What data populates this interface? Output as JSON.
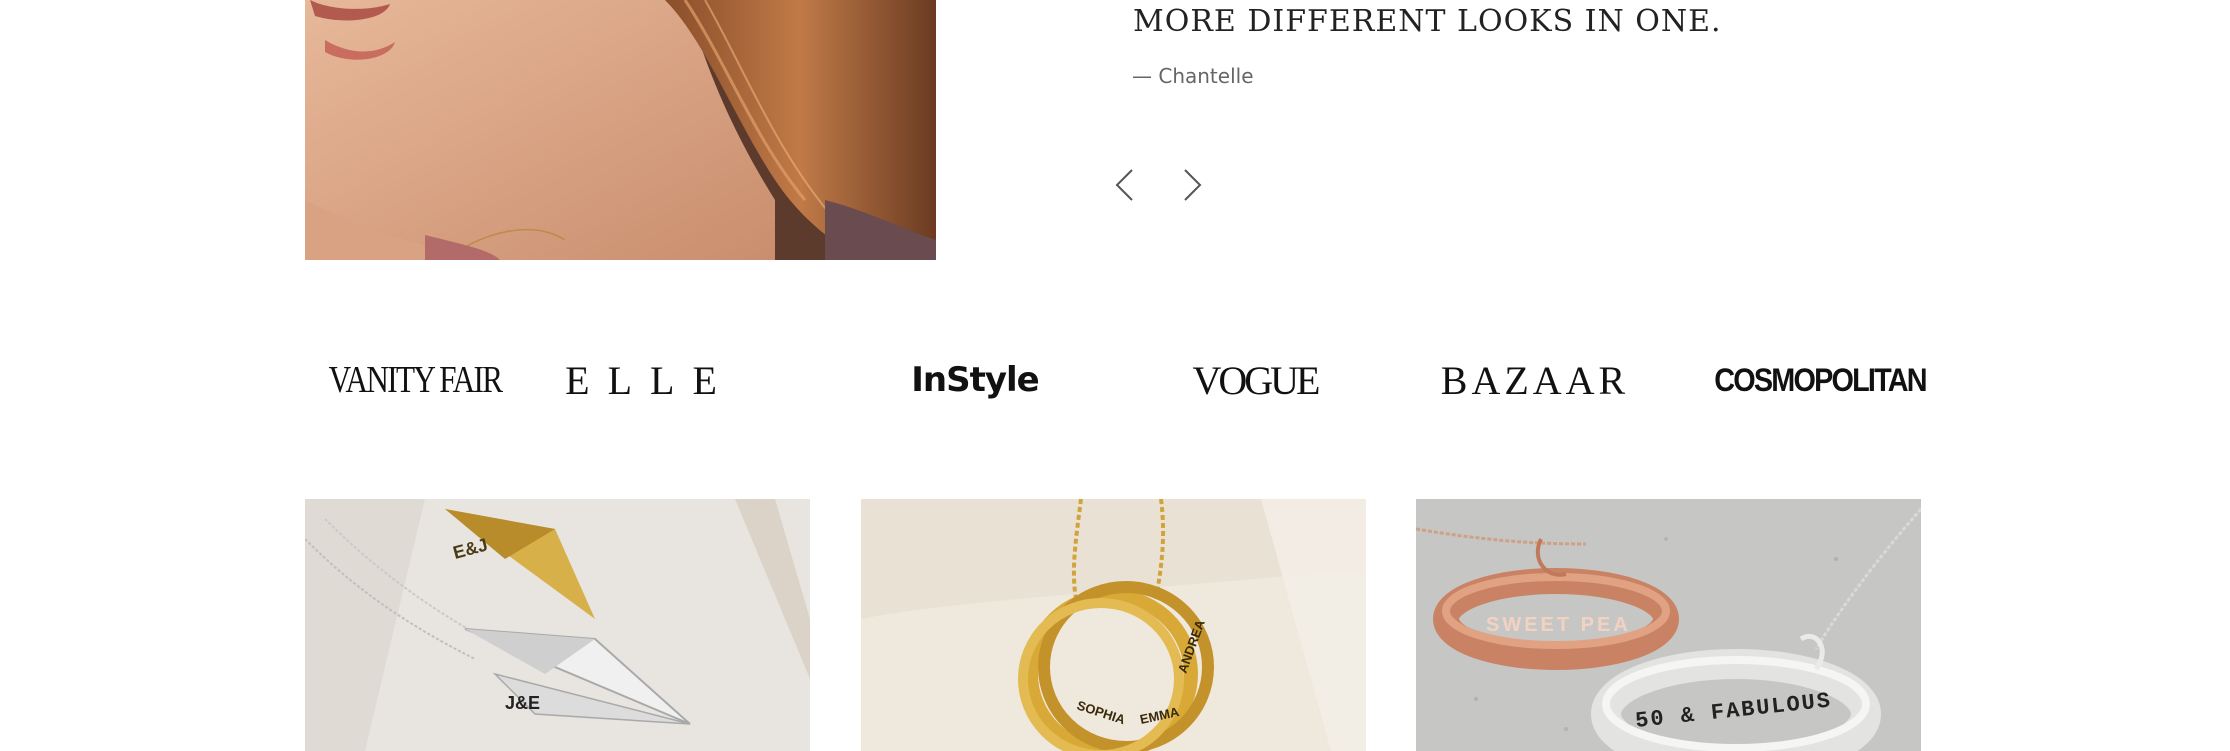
{
  "testimonial": {
    "quote": "MORE DIFFERENT LOOKS IN ONE.",
    "author": "— Chantelle"
  },
  "carousel": {
    "prev_icon": "chevron-left-icon",
    "next_icon": "chevron-right-icon"
  },
  "press_logos": [
    {
      "label": "VANITY FAIR"
    },
    {
      "label": "ELLE"
    },
    {
      "label": "InStyle"
    },
    {
      "label": "VOGUE"
    },
    {
      "label": "BAZAAR"
    },
    {
      "label": "COSMOPOLITAN"
    }
  ],
  "products": [
    {
      "engraving_top": "E&J",
      "engraving_bottom": "J&E"
    },
    {
      "engraving_names": [
        "SOPHIA",
        "EMMA",
        "ANDREA"
      ]
    },
    {
      "engraving_top": "SWEET PEA",
      "engraving_bottom": "50 & FABULOUS"
    }
  ]
}
